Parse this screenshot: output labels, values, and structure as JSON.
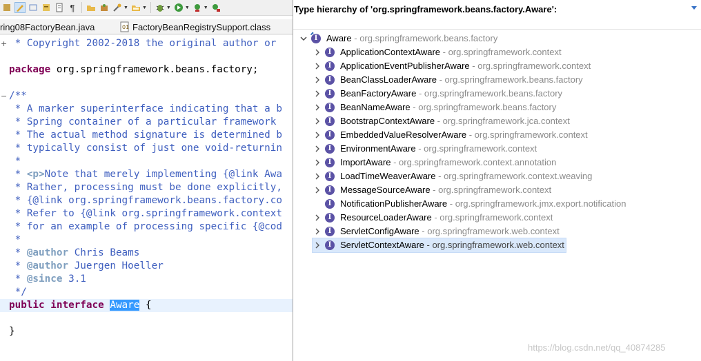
{
  "editor": {
    "tabs": [
      {
        "label": "ring08FactoryBean.java"
      },
      {
        "label": "FactoryBeanRegistrySupport.class"
      }
    ],
    "lines": [
      {
        "fold": "+",
        "parts": [
          {
            "c": "cm",
            "t": " * Copyright 2002-2018 the original author or"
          }
        ]
      },
      {
        "fold": "",
        "parts": [
          {
            "c": "",
            "t": ""
          }
        ]
      },
      {
        "fold": "",
        "parts": [
          {
            "c": "kw",
            "t": "package"
          },
          {
            "c": "",
            "t": " org.springframework.beans.factory;"
          }
        ]
      },
      {
        "fold": "",
        "parts": [
          {
            "c": "",
            "t": ""
          }
        ]
      },
      {
        "fold": "−",
        "parts": [
          {
            "c": "cm",
            "t": "/**"
          }
        ]
      },
      {
        "fold": "",
        "parts": [
          {
            "c": "cm",
            "t": " * A marker superinterface indicating that a b"
          }
        ]
      },
      {
        "fold": "",
        "parts": [
          {
            "c": "cm",
            "t": " * Spring container of a particular framework"
          }
        ]
      },
      {
        "fold": "",
        "parts": [
          {
            "c": "cm",
            "t": " * The actual method signature is determined b"
          }
        ]
      },
      {
        "fold": "",
        "parts": [
          {
            "c": "cm",
            "t": " * typically consist of just one void-returnin"
          }
        ]
      },
      {
        "fold": "",
        "parts": [
          {
            "c": "cm",
            "t": " *"
          }
        ]
      },
      {
        "fold": "",
        "parts": [
          {
            "c": "cm",
            "t": " * "
          },
          {
            "c": "tg",
            "t": "<p>"
          },
          {
            "c": "cm",
            "t": "Note that merely implementing {@link Awa"
          }
        ]
      },
      {
        "fold": "",
        "parts": [
          {
            "c": "cm",
            "t": " * Rather, processing must be done explicitly,"
          }
        ]
      },
      {
        "fold": "",
        "parts": [
          {
            "c": "cm",
            "t": " * {@link org.springframework.beans.factory.co"
          }
        ]
      },
      {
        "fold": "",
        "parts": [
          {
            "c": "cm",
            "t": " * Refer to {@link org.springframework.context"
          }
        ]
      },
      {
        "fold": "",
        "parts": [
          {
            "c": "cm",
            "t": " * for an example of processing specific {@cod"
          }
        ]
      },
      {
        "fold": "",
        "parts": [
          {
            "c": "cm",
            "t": " *"
          }
        ]
      },
      {
        "fold": "",
        "parts": [
          {
            "c": "cm",
            "t": " * "
          },
          {
            "c": "tg",
            "t": "@author"
          },
          {
            "c": "cm",
            "t": " Chris Beams"
          }
        ]
      },
      {
        "fold": "",
        "parts": [
          {
            "c": "cm",
            "t": " * "
          },
          {
            "c": "tg",
            "t": "@author"
          },
          {
            "c": "cm",
            "t": " Juergen Hoeller"
          }
        ]
      },
      {
        "fold": "",
        "parts": [
          {
            "c": "cm",
            "t": " * "
          },
          {
            "c": "tg",
            "t": "@since"
          },
          {
            "c": "cm",
            "t": " 3.1"
          }
        ]
      },
      {
        "fold": "",
        "parts": [
          {
            "c": "cm",
            "t": " */"
          }
        ]
      },
      {
        "fold": "",
        "cur": true,
        "parts": [
          {
            "c": "kw",
            "t": "public"
          },
          {
            "c": "",
            "t": " "
          },
          {
            "c": "kw",
            "t": "interface"
          },
          {
            "c": "",
            "t": " "
          },
          {
            "c": "hl",
            "t": "Aware"
          },
          {
            "c": "",
            "t": " {"
          }
        ]
      },
      {
        "fold": "",
        "parts": [
          {
            "c": "",
            "t": ""
          }
        ]
      },
      {
        "fold": "",
        "parts": [
          {
            "c": "",
            "t": "}"
          }
        ]
      }
    ]
  },
  "hierarchy": {
    "title": "Type hierarchy of 'org.springframework.beans.factory.Aware':",
    "root": {
      "name": "Aware",
      "sep": " - ",
      "pkg": "org.springframework.beans.factory"
    },
    "items": [
      {
        "name": "ApplicationContextAware",
        "sep": " - ",
        "pkg": "org.springframework.context",
        "expandable": true,
        "badge": "I"
      },
      {
        "name": "ApplicationEventPublisherAware",
        "sep": " - ",
        "pkg": "org.springframework.context",
        "expandable": true,
        "badge": "I"
      },
      {
        "name": "BeanClassLoaderAware",
        "sep": " - ",
        "pkg": "org.springframework.beans.factory",
        "expandable": true,
        "badge": "I"
      },
      {
        "name": "BeanFactoryAware",
        "sep": " - ",
        "pkg": "org.springframework.beans.factory",
        "expandable": true,
        "badge": "I"
      },
      {
        "name": "BeanNameAware",
        "sep": " - ",
        "pkg": "org.springframework.beans.factory",
        "expandable": true,
        "badge": "I"
      },
      {
        "name": "BootstrapContextAware",
        "sep": " - ",
        "pkg": "org.springframework.jca.context",
        "expandable": true,
        "badge": "I"
      },
      {
        "name": "EmbeddedValueResolverAware",
        "sep": " - ",
        "pkg": "org.springframework.context",
        "expandable": true,
        "badge": "I"
      },
      {
        "name": "EnvironmentAware",
        "sep": " - ",
        "pkg": "org.springframework.context",
        "expandable": true,
        "badge": "I"
      },
      {
        "name": "ImportAware",
        "sep": " - ",
        "pkg": "org.springframework.context.annotation",
        "expandable": true,
        "badge": "I"
      },
      {
        "name": "LoadTimeWeaverAware",
        "sep": " - ",
        "pkg": "org.springframework.context.weaving",
        "expandable": true,
        "badge": "I"
      },
      {
        "name": "MessageSourceAware",
        "sep": " - ",
        "pkg": "org.springframework.context",
        "expandable": true,
        "badge": "I"
      },
      {
        "name": "NotificationPublisherAware",
        "sep": " - ",
        "pkg": "org.springframework.jmx.export.notification",
        "expandable": false,
        "badge": "I"
      },
      {
        "name": "ResourceLoaderAware",
        "sep": " - ",
        "pkg": "org.springframework.context",
        "expandable": true,
        "badge": "I"
      },
      {
        "name": "ServletConfigAware",
        "sep": " - ",
        "pkg": "org.springframework.web.context",
        "expandable": true,
        "badge": "I"
      },
      {
        "name": "ServletContextAware",
        "sep": " - ",
        "pkg": "org.springframework.web.context",
        "expandable": true,
        "badge": "I",
        "selected": true
      }
    ]
  },
  "watermark": "https://blog.csdn.net/qq_40874285",
  "colors": {
    "comment": "#3f5fbf",
    "keyword": "#7f0055",
    "interface_badge": "#5b52a5",
    "selection": "#d9e8fb",
    "highlight": "#3399ff"
  }
}
